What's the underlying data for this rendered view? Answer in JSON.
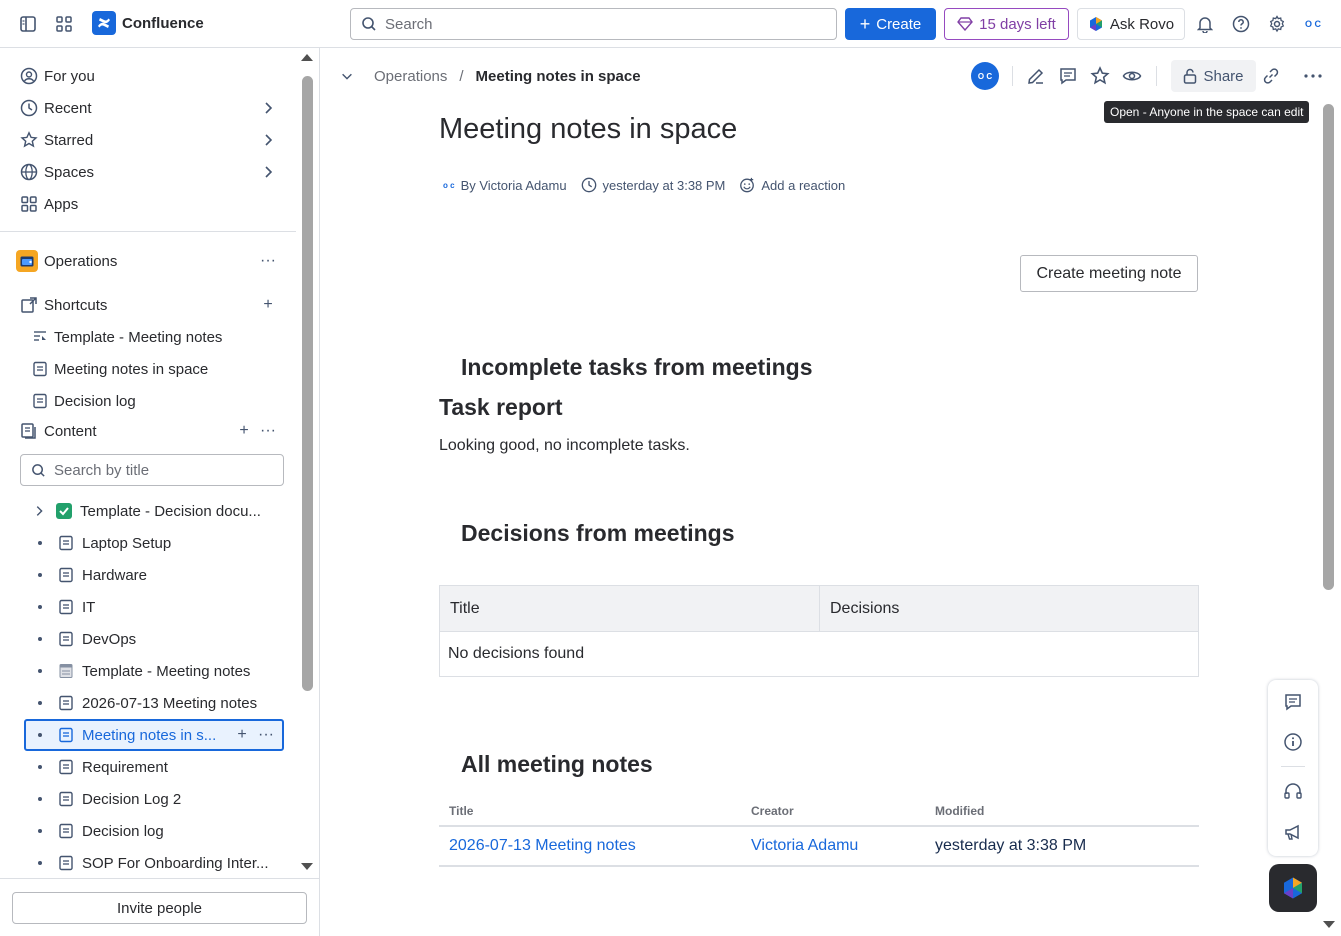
{
  "topbar": {
    "app_name": "Confluence",
    "search_placeholder": "Search",
    "create_label": "Create",
    "trial_label": "15 days left",
    "rovo_label": "Ask Rovo",
    "avatar_initials": "O C"
  },
  "sidebar": {
    "nav": [
      {
        "label": "For you"
      },
      {
        "label": "Recent"
      },
      {
        "label": "Starred"
      },
      {
        "label": "Spaces"
      },
      {
        "label": "Apps"
      }
    ],
    "space_name": "Operations",
    "shortcuts_label": "Shortcuts",
    "shortcuts": [
      {
        "label": "Template - Meeting notes"
      },
      {
        "label": "Meeting notes in space"
      },
      {
        "label": "Decision log"
      }
    ],
    "content_label": "Content",
    "tree_search_placeholder": "Search by title",
    "tree": [
      {
        "label": "Template - Decision docu...",
        "icon": "check-emoji-icon"
      },
      {
        "label": "Laptop Setup",
        "icon": "page-icon"
      },
      {
        "label": "Hardware",
        "icon": "page-icon"
      },
      {
        "label": "IT",
        "icon": "page-icon"
      },
      {
        "label": "DevOps",
        "icon": "page-icon"
      },
      {
        "label": "Template - Meeting notes",
        "icon": "notepad-emoji-icon"
      },
      {
        "label": "2026-07-13 Meeting notes",
        "icon": "page-icon"
      },
      {
        "label": "Meeting notes in s...",
        "icon": "page-icon",
        "selected": true
      },
      {
        "label": "Requirement",
        "icon": "page-icon"
      },
      {
        "label": "Decision Log 2",
        "icon": "page-icon"
      },
      {
        "label": "Decision log",
        "icon": "page-icon"
      },
      {
        "label": "SOP For Onboarding Inter...",
        "icon": "page-icon"
      }
    ],
    "invite_label": "Invite people"
  },
  "main": {
    "breadcrumb_space": "Operations",
    "breadcrumb_sep": "/",
    "breadcrumb_current": "Meeting notes in space",
    "owner_initials": "O C",
    "share_label": "Share",
    "tooltip": "Open - Anyone in the space can edit",
    "title": "Meeting notes in space",
    "author": "By Victoria Adamu",
    "timestamp": "yesterday at 3:38 PM",
    "reaction_label": "Add a reaction",
    "create_meeting_note": "Create meeting note",
    "incomplete_heading": "Incomplete tasks from meetings",
    "task_report_heading": "Task report",
    "task_report_text": "Looking good, no incomplete tasks.",
    "decisions_heading": "Decisions from meetings",
    "decisions_table": {
      "headers": [
        "Title",
        "Decisions"
      ],
      "empty_text": "No decisions found"
    },
    "all_notes_heading": "All meeting notes",
    "notes_table": {
      "headers": [
        "Title",
        "Creator",
        "Modified"
      ],
      "rows": [
        {
          "title": "2026-07-13 Meeting notes",
          "creator": "Victoria Adamu",
          "modified": "yesterday at 3:38 PM"
        }
      ]
    }
  },
  "colors": {
    "brand": "#1868db",
    "trial": "#803fa5",
    "text": "#292a2e",
    "subtle": "#44546f"
  }
}
